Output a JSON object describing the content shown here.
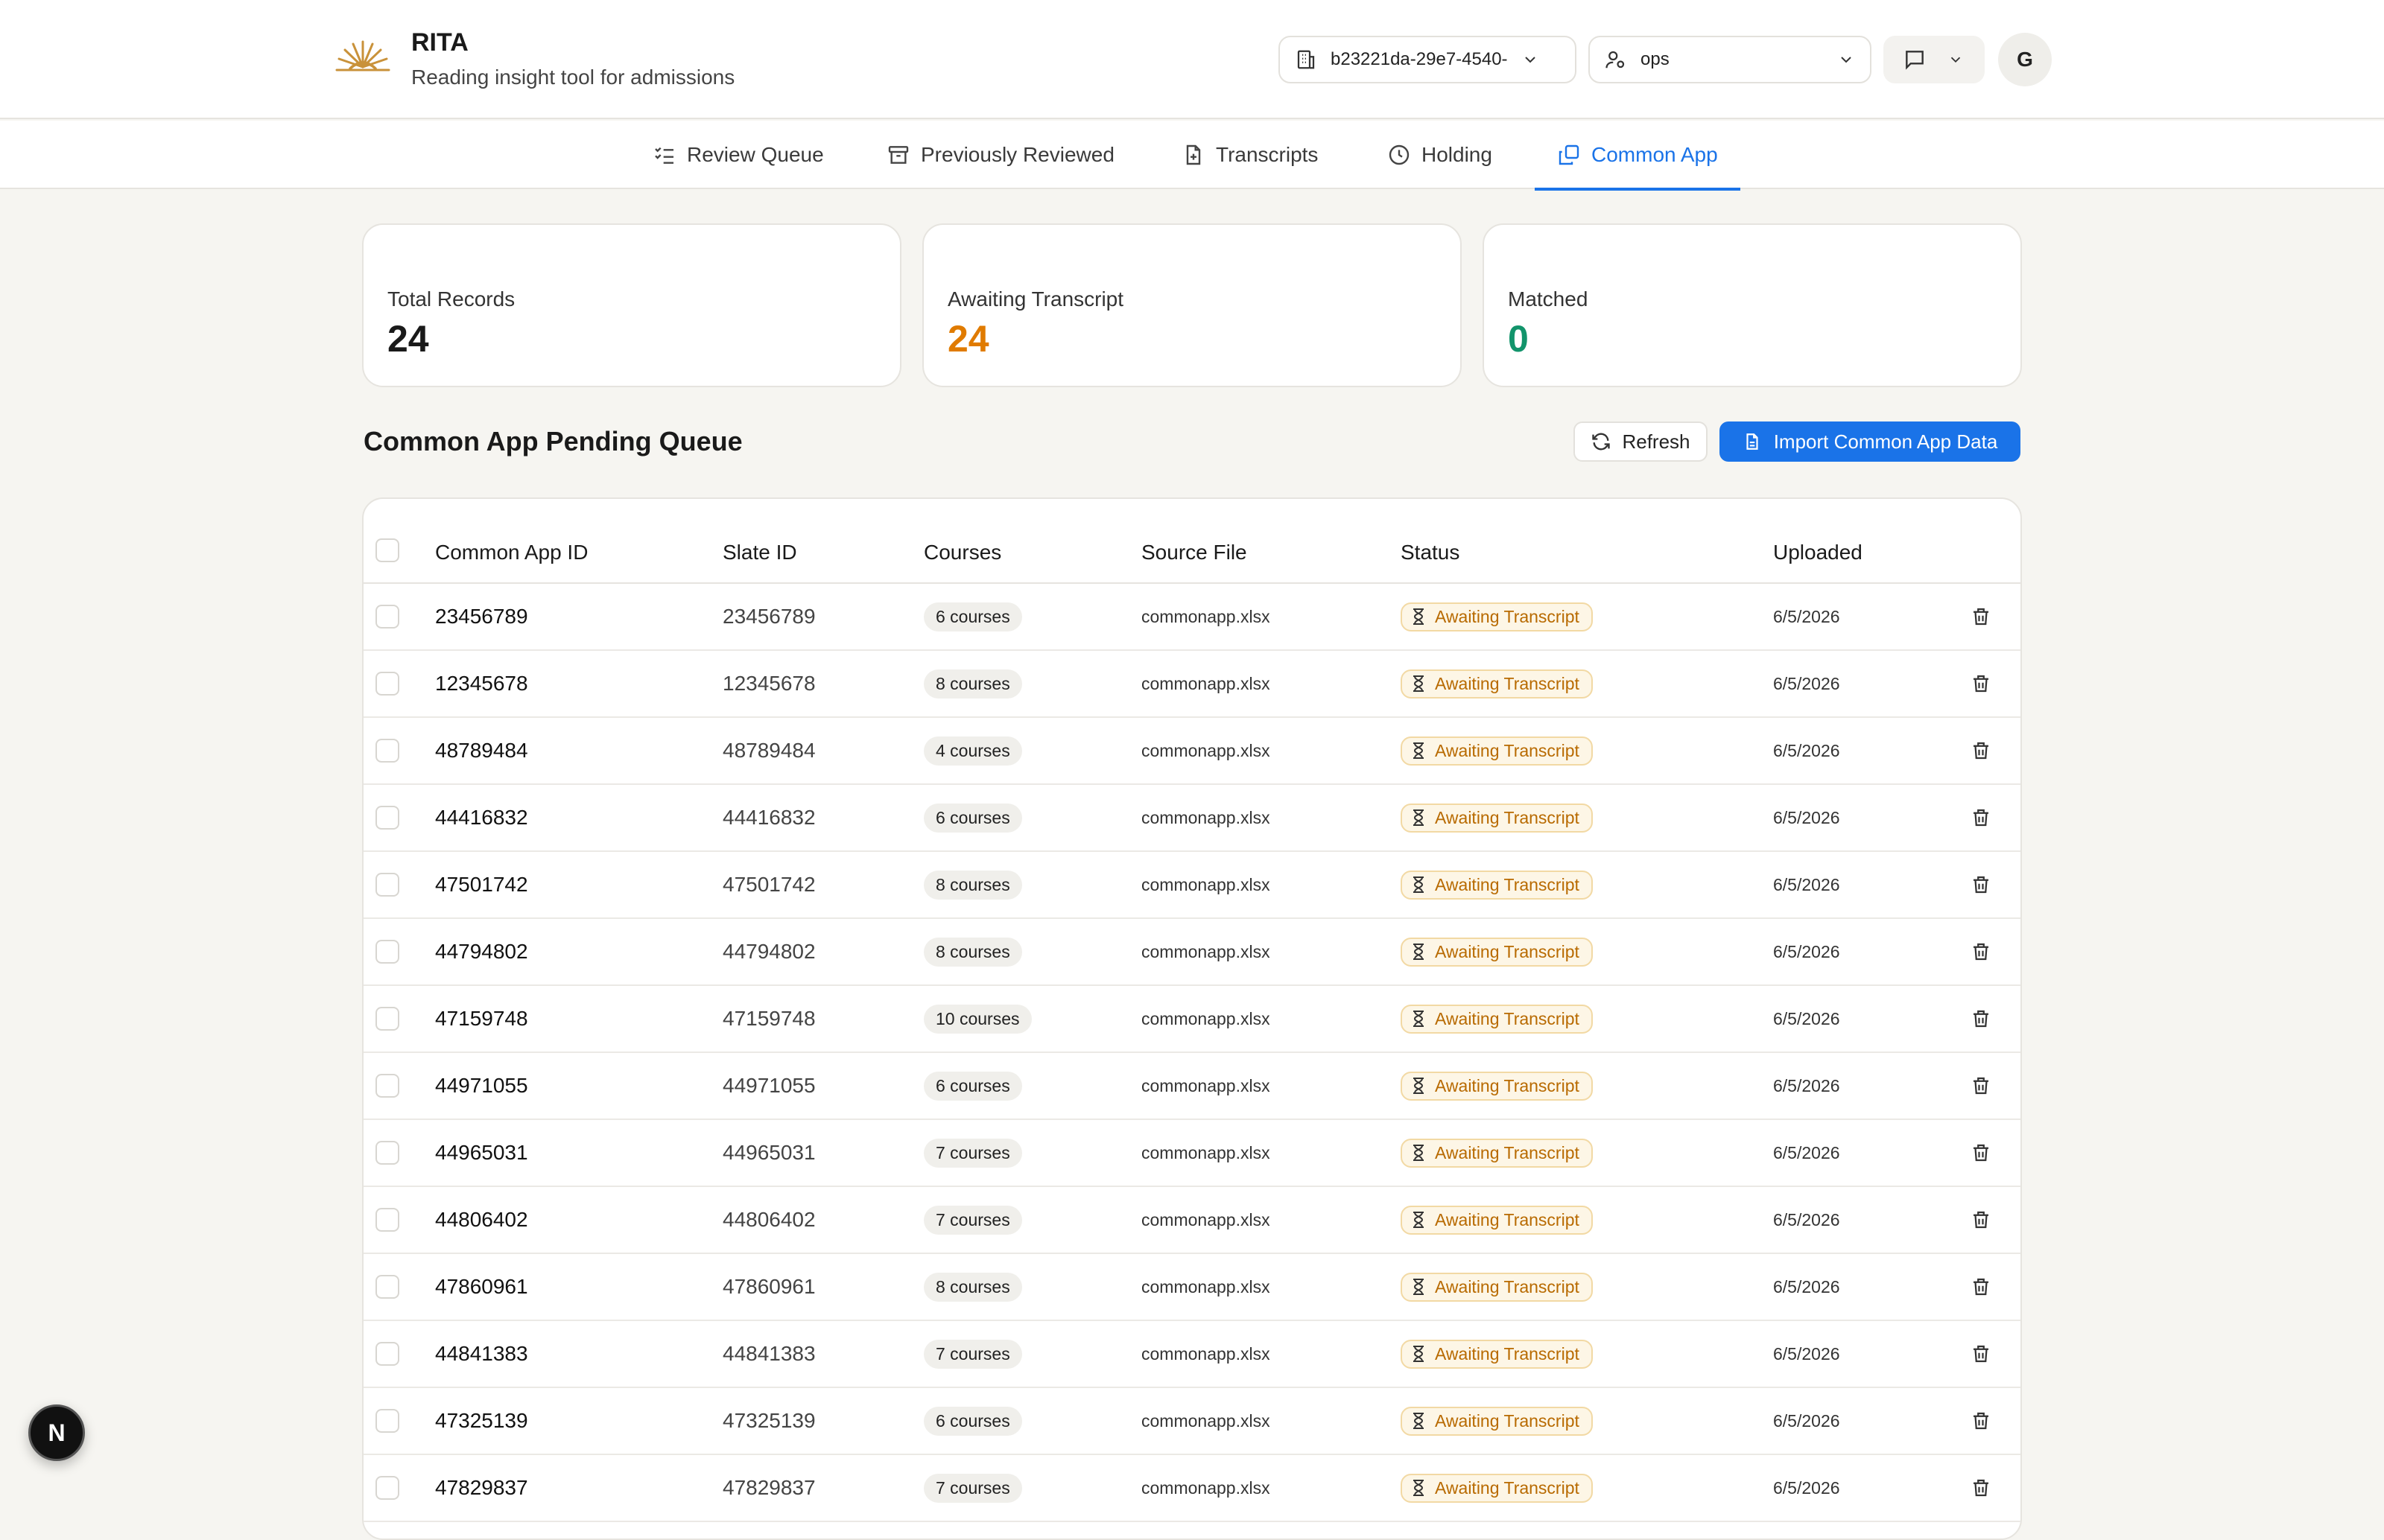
{
  "header": {
    "title": "RITA",
    "subtitle": "Reading insight tool for admissions",
    "org_value": "b23221da-29e7-4540-",
    "role_value": "ops",
    "avatar_initial": "G"
  },
  "tabs": [
    {
      "label": "Review Queue",
      "icon": "checklist-icon",
      "active": false
    },
    {
      "label": "Previously Reviewed",
      "icon": "archive-icon",
      "active": false
    },
    {
      "label": "Transcripts",
      "icon": "file-plus-icon",
      "active": false
    },
    {
      "label": "Holding",
      "icon": "clock-icon",
      "active": false
    },
    {
      "label": "Common App",
      "icon": "copy-icon",
      "active": true
    }
  ],
  "stats": [
    {
      "label": "Total Records",
      "value": "24",
      "color": "#1a1a1a"
    },
    {
      "label": "Awaiting Transcript",
      "value": "24",
      "color": "#e07b00"
    },
    {
      "label": "Matched",
      "value": "0",
      "color": "#12946b"
    }
  ],
  "queue": {
    "title": "Common App Pending Queue",
    "refresh_label": "Refresh",
    "import_label": "Import Common App Data",
    "columns": [
      "Common App ID",
      "Slate ID",
      "Courses",
      "Source File",
      "Status",
      "Uploaded"
    ],
    "rows": [
      {
        "id": "23456789",
        "slate": "23456789",
        "courses": "6 courses",
        "file": "commonapp.xlsx",
        "status": "Awaiting Transcript",
        "date": "6/5/2026"
      },
      {
        "id": "12345678",
        "slate": "12345678",
        "courses": "8 courses",
        "file": "commonapp.xlsx",
        "status": "Awaiting Transcript",
        "date": "6/5/2026"
      },
      {
        "id": "48789484",
        "slate": "48789484",
        "courses": "4 courses",
        "file": "commonapp.xlsx",
        "status": "Awaiting Transcript",
        "date": "6/5/2026"
      },
      {
        "id": "44416832",
        "slate": "44416832",
        "courses": "6 courses",
        "file": "commonapp.xlsx",
        "status": "Awaiting Transcript",
        "date": "6/5/2026"
      },
      {
        "id": "47501742",
        "slate": "47501742",
        "courses": "8 courses",
        "file": "commonapp.xlsx",
        "status": "Awaiting Transcript",
        "date": "6/5/2026"
      },
      {
        "id": "44794802",
        "slate": "44794802",
        "courses": "8 courses",
        "file": "commonapp.xlsx",
        "status": "Awaiting Transcript",
        "date": "6/5/2026"
      },
      {
        "id": "47159748",
        "slate": "47159748",
        "courses": "10 courses",
        "file": "commonapp.xlsx",
        "status": "Awaiting Transcript",
        "date": "6/5/2026"
      },
      {
        "id": "44971055",
        "slate": "44971055",
        "courses": "6 courses",
        "file": "commonapp.xlsx",
        "status": "Awaiting Transcript",
        "date": "6/5/2026"
      },
      {
        "id": "44965031",
        "slate": "44965031",
        "courses": "7 courses",
        "file": "commonapp.xlsx",
        "status": "Awaiting Transcript",
        "date": "6/5/2026"
      },
      {
        "id": "44806402",
        "slate": "44806402",
        "courses": "7 courses",
        "file": "commonapp.xlsx",
        "status": "Awaiting Transcript",
        "date": "6/5/2026"
      },
      {
        "id": "47860961",
        "slate": "47860961",
        "courses": "8 courses",
        "file": "commonapp.xlsx",
        "status": "Awaiting Transcript",
        "date": "6/5/2026"
      },
      {
        "id": "44841383",
        "slate": "44841383",
        "courses": "7 courses",
        "file": "commonapp.xlsx",
        "status": "Awaiting Transcript",
        "date": "6/5/2026"
      },
      {
        "id": "47325139",
        "slate": "47325139",
        "courses": "6 courses",
        "file": "commonapp.xlsx",
        "status": "Awaiting Transcript",
        "date": "6/5/2026"
      },
      {
        "id": "47829837",
        "slate": "47829837",
        "courses": "7 courses",
        "file": "commonapp.xlsx",
        "status": "Awaiting Transcript",
        "date": "6/5/2026"
      }
    ]
  },
  "badge": {
    "label": "N"
  },
  "colors": {
    "accent": "#1a73e8",
    "awaiting": "#e07b00",
    "matched": "#12946b"
  }
}
